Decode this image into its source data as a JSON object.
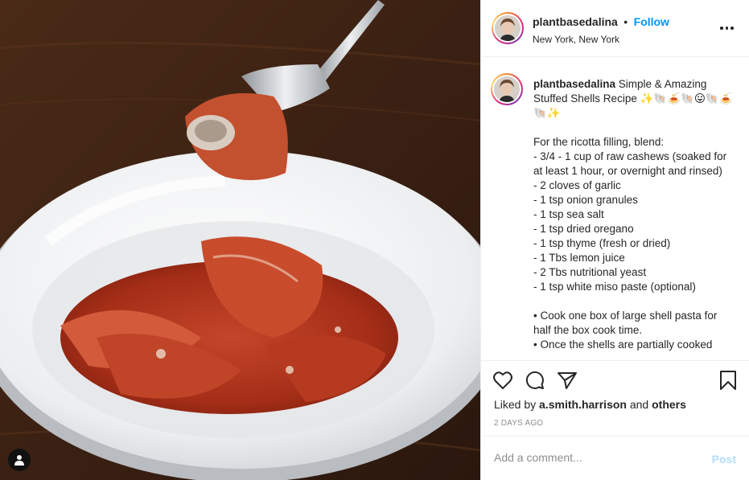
{
  "post": {
    "photo_alt": "Stuffed shells pasta in a white bowl with a fork",
    "user_tag_icon": "person-icon"
  },
  "header": {
    "username": "plantbasedalina",
    "separator": "•",
    "follow_label": "Follow",
    "location": "New York, New York",
    "more_icon": "more-horizontal-icon"
  },
  "caption": {
    "username": "plantbasedalina",
    "title": " Simple & Amazing Stuffed Shells Recipe ✨🐚🍝🐚😛🐚🍝🐚✨",
    "body": "For the ricotta filling, blend:\n- 3/4 - 1 cup of raw cashews (soaked for at least 1 hour, or overnight and rinsed)\n- 2 cloves of garlic\n- 1 tsp onion granules\n- 1 tsp sea salt\n- 1 tsp dried oregano\n- 1 tsp thyme (fresh or dried)\n- 1 Tbs lemon juice\n- 2 Tbs nutritional yeast\n- 1 tsp white miso paste (optional)",
    "steps": "• Cook one box of large shell pasta for half the box cook time.\n• Once the shells are partially cooked"
  },
  "actions": {
    "like_icon": "heart-icon",
    "comment_icon": "comment-icon",
    "share_icon": "paper-plane-icon",
    "save_icon": "bookmark-icon",
    "liked_prefix": "Liked by ",
    "liked_user": "a.smith.harrison",
    "liked_and": " and ",
    "liked_others": "others",
    "timestamp": "2 days ago"
  },
  "comment": {
    "placeholder": "Add a comment...",
    "post_label": "Post",
    "post_color": "#b2dffc"
  },
  "colors": {
    "link": "#0095f6",
    "text": "#262626",
    "muted": "#8e8e8e",
    "border": "#efefef"
  }
}
